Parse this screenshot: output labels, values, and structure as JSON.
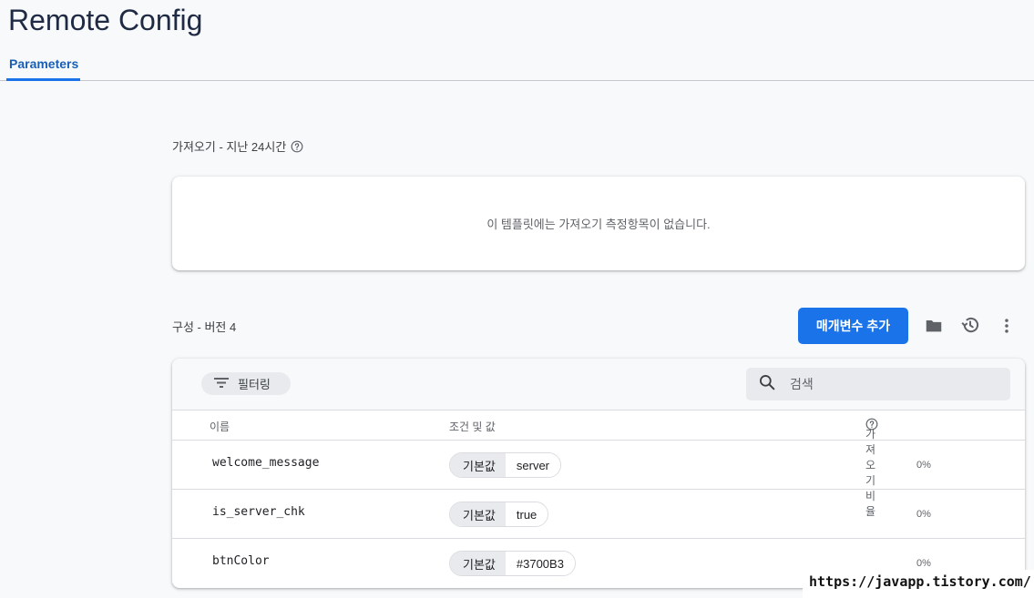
{
  "app": {
    "title": "Remote Config"
  },
  "tabs": [
    {
      "label": "Parameters"
    }
  ],
  "fetch_section": {
    "title": "가져오기 - 지난 24시간",
    "empty_message": "이 템플릿에는 가져오기 측정항목이 없습니다."
  },
  "config_section": {
    "title": "구성 - 버전 4",
    "add_button_label": "매개변수 추가"
  },
  "toolbar": {
    "filter_label": "필터링",
    "search_placeholder": "검색"
  },
  "table": {
    "columns": {
      "name": "이름",
      "conditions": "조건 및 값",
      "fetch_rate": "가져오기 비율"
    },
    "rows": [
      {
        "name": "welcome_message",
        "key": "기본값",
        "value": "server",
        "fetch": "0%"
      },
      {
        "name": "is_server_chk",
        "key": "기본값",
        "value": "true",
        "fetch": "0%"
      },
      {
        "name": "btnColor",
        "key": "기본값",
        "value": "#3700B3",
        "fetch": "0%"
      }
    ]
  },
  "watermark": {
    "text": "https://javapp.tistory.com/"
  },
  "colors": {
    "primary": "#1a73e8",
    "tab_active": "#1a5fb4",
    "title": "#1f2a44"
  }
}
